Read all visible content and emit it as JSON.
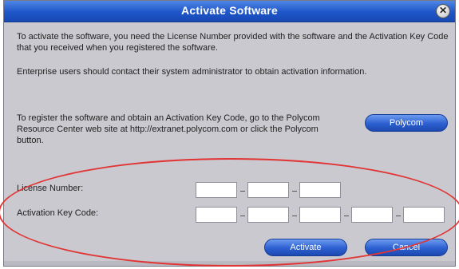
{
  "window": {
    "title": "Activate Software",
    "close_glyph": "✕"
  },
  "intro": {
    "line1": "To activate the software, you need the License Number provided with the software and the Activation Key Code that you received when you registered the software.",
    "line2": "Enterprise users should contact their system administrator to obtain activation information."
  },
  "register": {
    "text": "To register the software and obtain an Activation Key Code, go to the Polycom Resource Center web site at http://extranet.polycom.com or click the Polycom button.",
    "button_label": "Polycom"
  },
  "license": {
    "label": "License Number:",
    "fields": [
      "",
      "",
      ""
    ]
  },
  "activation": {
    "label": "Activation Key Code:",
    "fields": [
      "",
      "",
      "",
      "",
      ""
    ]
  },
  "buttons": {
    "activate": "Activate",
    "cancel": "Cancel"
  },
  "colors": {
    "titlebar": "#1e55c8",
    "accent_circle": "#e23434",
    "dialog_bg": "#c9c9cf"
  }
}
